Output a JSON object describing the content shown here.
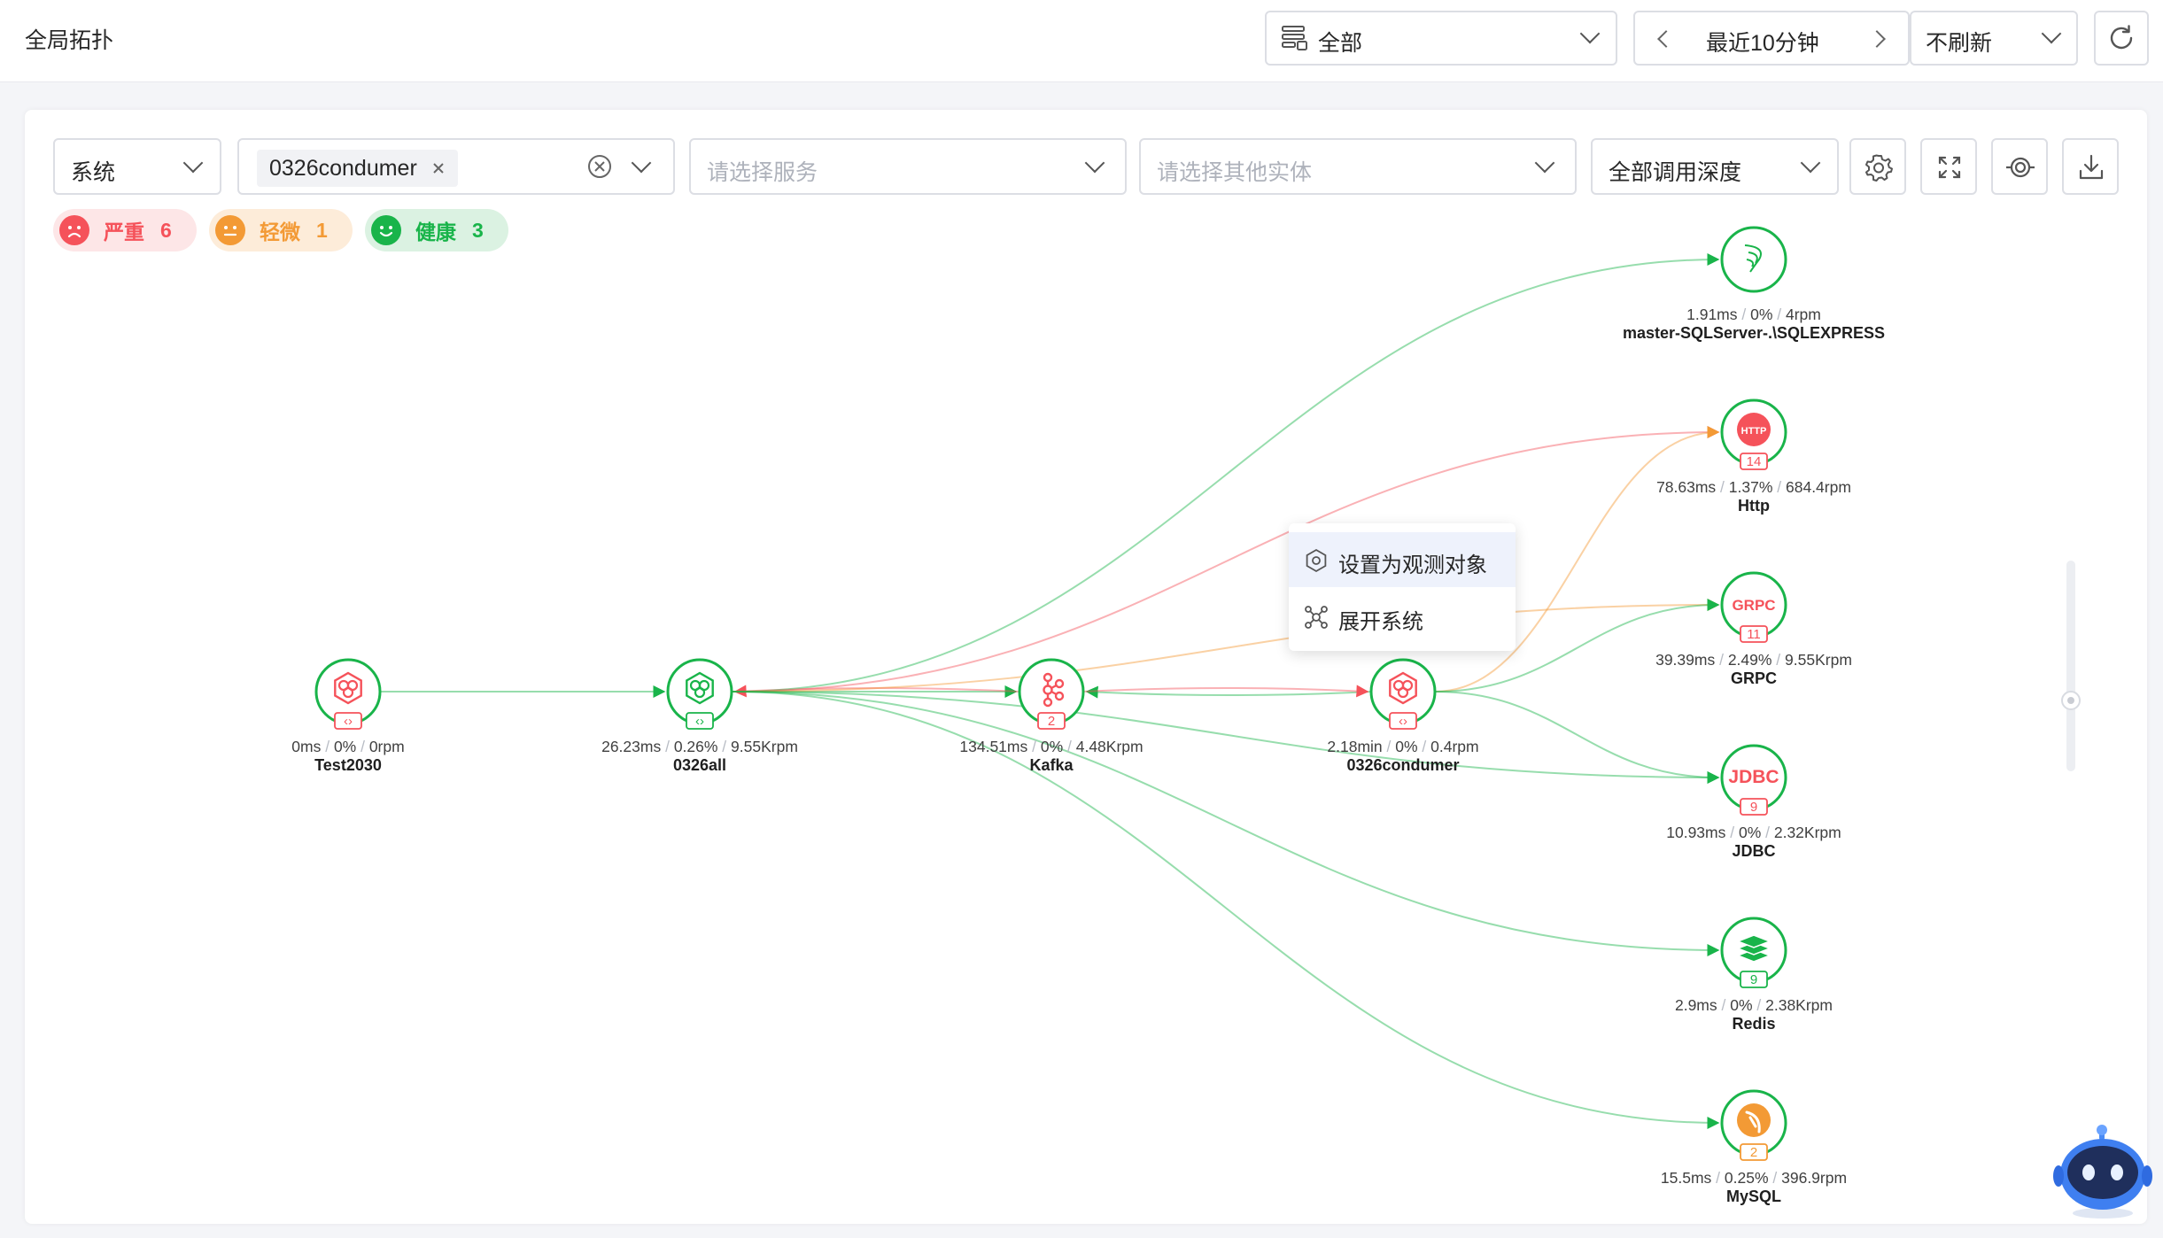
{
  "header": {
    "title": "全局拓扑",
    "scope_select": "全部",
    "time_range": "最近10分钟",
    "refresh_select": "不刷新"
  },
  "filters": {
    "type_select": "系统",
    "selected_tag": "0326condumer",
    "service_placeholder": "请选择服务",
    "entity_placeholder": "请选择其他实体",
    "depth_select": "全部调用深度"
  },
  "status_summary": [
    {
      "label": "严重",
      "count": "6",
      "color": "#f5525a",
      "bg": "#fde6e7"
    },
    {
      "label": "轻微",
      "count": "1",
      "color": "#f39a35",
      "bg": "#fdecd9"
    },
    {
      "label": "健康",
      "count": "3",
      "color": "#19b44a",
      "bg": "#dbf2e2"
    }
  ],
  "context_menu": {
    "set_observe": "设置为观测对象",
    "expand_system": "展开系统"
  },
  "nodes": [
    {
      "id": "test2030",
      "name": "Test2030",
      "latency": "0ms",
      "error": "0%",
      "rate": "0rpm",
      "icon": "system-icon",
      "ring": "#19b44a",
      "icon_color": "#f5525a",
      "badge": "‹›",
      "badge_color": "#f5525a"
    },
    {
      "id": "0326all",
      "name": "0326all",
      "latency": "26.23ms",
      "error": "0.26%",
      "rate": "9.55Krpm",
      "icon": "system-icon",
      "ring": "#19b44a",
      "icon_color": "#19b44a",
      "badge": "‹›",
      "badge_color": "#19b44a"
    },
    {
      "id": "kafka",
      "name": "Kafka",
      "latency": "134.51ms",
      "error": "0%",
      "rate": "4.48Krpm",
      "icon": "kafka-icon",
      "ring": "#19b44a",
      "icon_color": "#f5525a",
      "badge": "2",
      "badge_color": "#f5525a"
    },
    {
      "id": "0326condumer",
      "name": "0326condumer",
      "latency": "2.18min",
      "error": "0%",
      "rate": "0.4rpm",
      "icon": "system-icon",
      "ring": "#19b44a",
      "icon_color": "#f5525a",
      "badge": "‹›",
      "badge_color": "#f5525a"
    },
    {
      "id": "sqlserver",
      "name": "master-SQLServer-.\\SQLEXPRESS",
      "latency": "1.91ms",
      "error": "0%",
      "rate": "4rpm",
      "icon": "sqlserver-icon",
      "ring": "#19b44a",
      "icon_color": "#19b44a",
      "badge": "",
      "badge_color": ""
    },
    {
      "id": "http",
      "name": "Http",
      "latency": "78.63ms",
      "error": "1.37%",
      "rate": "684.4rpm",
      "icon": "http-icon",
      "ring": "#19b44a",
      "icon_color": "#f5525a",
      "badge": "14",
      "badge_color": "#f5525a",
      "icon_text": "HTTP"
    },
    {
      "id": "grpc",
      "name": "GRPC",
      "latency": "39.39ms",
      "error": "2.49%",
      "rate": "9.55Krpm",
      "icon": "grpc-icon",
      "ring": "#19b44a",
      "icon_color": "#f5525a",
      "badge": "11",
      "badge_color": "#f5525a",
      "icon_text": "GRPC"
    },
    {
      "id": "jdbc",
      "name": "JDBC",
      "latency": "10.93ms",
      "error": "0%",
      "rate": "2.32Krpm",
      "icon": "jdbc-icon",
      "ring": "#19b44a",
      "icon_color": "#f5525a",
      "badge": "9",
      "badge_color": "#f5525a",
      "icon_text": "JDBC"
    },
    {
      "id": "redis",
      "name": "Redis",
      "latency": "2.9ms",
      "error": "0%",
      "rate": "2.38Krpm",
      "icon": "redis-icon",
      "ring": "#19b44a",
      "icon_color": "#19b44a",
      "badge": "9",
      "badge_color": "#19b44a"
    },
    {
      "id": "mysql",
      "name": "MySQL",
      "latency": "15.5ms",
      "error": "0.25%",
      "rate": "396.9rpm",
      "icon": "mysql-icon",
      "ring": "#19b44a",
      "icon_color": "#f39a35",
      "badge": "2",
      "badge_color": "#f39a35"
    }
  ],
  "edges": [
    {
      "from": "test2030",
      "to": "0326all",
      "color": "#19b44a"
    },
    {
      "from": "0326all",
      "to": "kafka",
      "color": "#19b44a"
    },
    {
      "from": "kafka",
      "to": "0326all",
      "color": "#f5525a"
    },
    {
      "from": "0326condumer",
      "to": "kafka",
      "color": "#19b44a"
    },
    {
      "from": "kafka",
      "to": "0326condumer",
      "color": "#f5525a"
    },
    {
      "from": "0326all",
      "to": "sqlserver",
      "color": "#19b44a"
    },
    {
      "from": "0326all",
      "to": "http",
      "color": "#f5525a"
    },
    {
      "from": "0326all",
      "to": "grpc",
      "color": "#f39a35"
    },
    {
      "from": "0326all",
      "to": "jdbc",
      "color": "#19b44a"
    },
    {
      "from": "0326all",
      "to": "redis",
      "color": "#19b44a"
    },
    {
      "from": "0326all",
      "to": "mysql",
      "color": "#19b44a"
    },
    {
      "from": "0326condumer",
      "to": "http",
      "color": "#f39a35"
    },
    {
      "from": "0326condumer",
      "to": "grpc",
      "color": "#19b44a"
    },
    {
      "from": "0326condumer",
      "to": "jdbc",
      "color": "#19b44a"
    }
  ]
}
